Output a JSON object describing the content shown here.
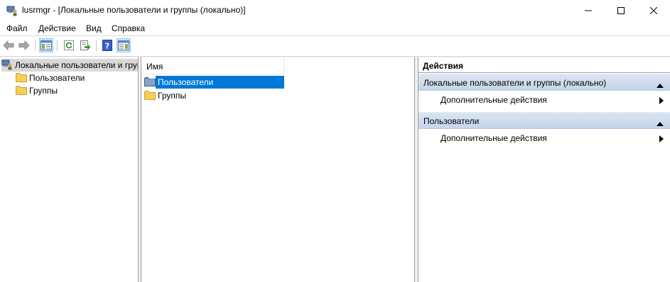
{
  "window": {
    "title": "lusrmgr - [Локальные пользователи и группы (локально)]"
  },
  "menu": {
    "items": [
      "Файл",
      "Действие",
      "Вид",
      "Справка"
    ]
  },
  "tree": {
    "root": "Локальные пользователи и группы (локально)",
    "children": [
      "Пользователи",
      "Группы"
    ]
  },
  "list": {
    "column_header": "Имя",
    "rows": [
      {
        "label": "Пользователи",
        "selected": true
      },
      {
        "label": "Группы",
        "selected": false
      }
    ]
  },
  "actions": {
    "title": "Действия",
    "groups": [
      {
        "label": "Локальные пользователи и группы (локально)",
        "item": "Дополнительные действия"
      },
      {
        "label": "Пользователи",
        "item": "Дополнительные действия"
      }
    ]
  },
  "colors": {
    "selection": "#0078d7",
    "action_header": "#c5d5ea",
    "folder": "#f6cf5b"
  }
}
